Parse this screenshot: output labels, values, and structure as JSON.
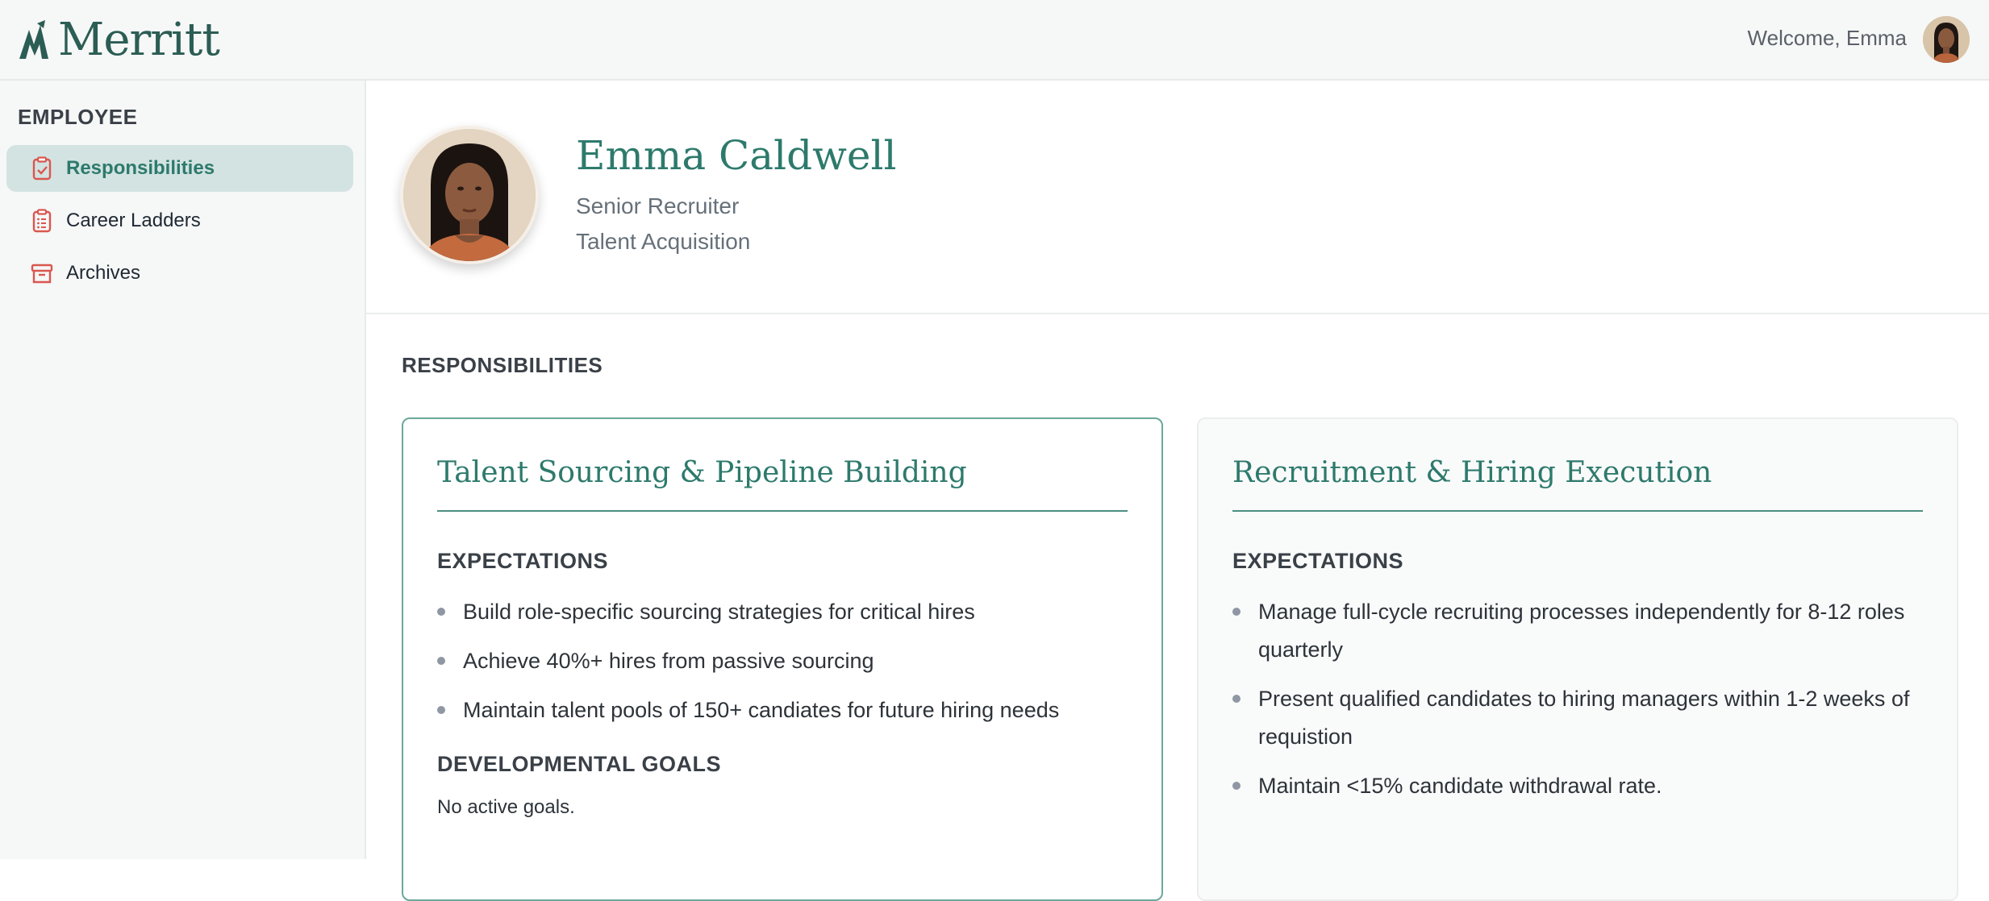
{
  "header": {
    "brand": "Merritt",
    "welcome": "Welcome, Emma"
  },
  "sidebar": {
    "heading": "EMPLOYEE",
    "items": [
      {
        "label": "Responsibilities",
        "icon": "clipboard-check-icon",
        "active": true
      },
      {
        "label": "Career Ladders",
        "icon": "clipboard-list-icon",
        "active": false
      },
      {
        "label": "Archives",
        "icon": "archive-box-icon",
        "active": false
      }
    ]
  },
  "profile": {
    "name": "Emma Caldwell",
    "role": "Senior Recruiter",
    "department": "Talent Acquisition"
  },
  "responsibilities": {
    "title": "RESPONSIBILITIES",
    "cards": [
      {
        "title": "Talent Sourcing & Pipeline Building",
        "expectations_label": "EXPECTATIONS",
        "expectations": [
          "Build role-specific sourcing strategies for critical hires",
          "Achieve 40%+ hires from passive sourcing",
          "Maintain talent pools of 150+ candiates for future hiring needs"
        ],
        "goals_label": "DEVELOPMENTAL GOALS",
        "goals_text": "No active goals."
      },
      {
        "title": "Recruitment & Hiring Execution",
        "expectations_label": "EXPECTATIONS",
        "expectations": [
          "Manage full-cycle recruiting processes independently for 8-12 roles quarterly",
          "Present qualified candidates to hiring managers within 1-2 weeks of requistion",
          "Maintain <15% candidate withdrawal rate."
        ]
      }
    ]
  },
  "colors": {
    "brand": "#2b5d54",
    "accent": "#2d7a6c",
    "active_bg": "#d3e3e2",
    "icon": "#d9574f"
  }
}
